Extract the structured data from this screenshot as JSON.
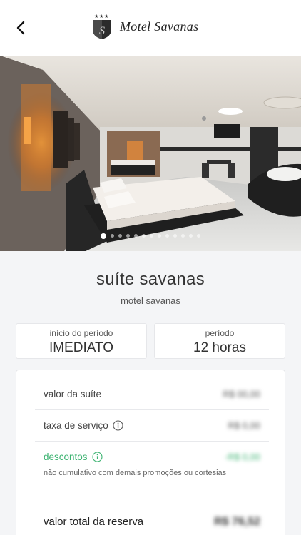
{
  "header": {
    "back_icon": "chevron-left-icon",
    "logo_text": "Motel Savanas",
    "logo_monogram": "S"
  },
  "gallery": {
    "total_slides": 13,
    "active_slide": 1
  },
  "suite": {
    "name": "suíte savanas",
    "motel": "motel savanas"
  },
  "booking": {
    "start_label": "início do período",
    "start_value": "IMEDIATO",
    "period_label": "período",
    "period_value": "12 horas"
  },
  "summary": {
    "suite_price_label": "valor da suíte",
    "suite_price_value": "R$ 00,00",
    "service_fee_label": "taxa de serviço",
    "service_fee_value": "R$ 0,00",
    "discount_label": "descontos",
    "discount_value": "-R$ 0,00",
    "discount_note": "não cumulativo com demais promoções ou cortesias",
    "total_label": "valor total da reserva",
    "total_value": "R$ 76,52"
  },
  "colors": {
    "discount_green": "#3cb371",
    "background": "#f4f5f7"
  }
}
